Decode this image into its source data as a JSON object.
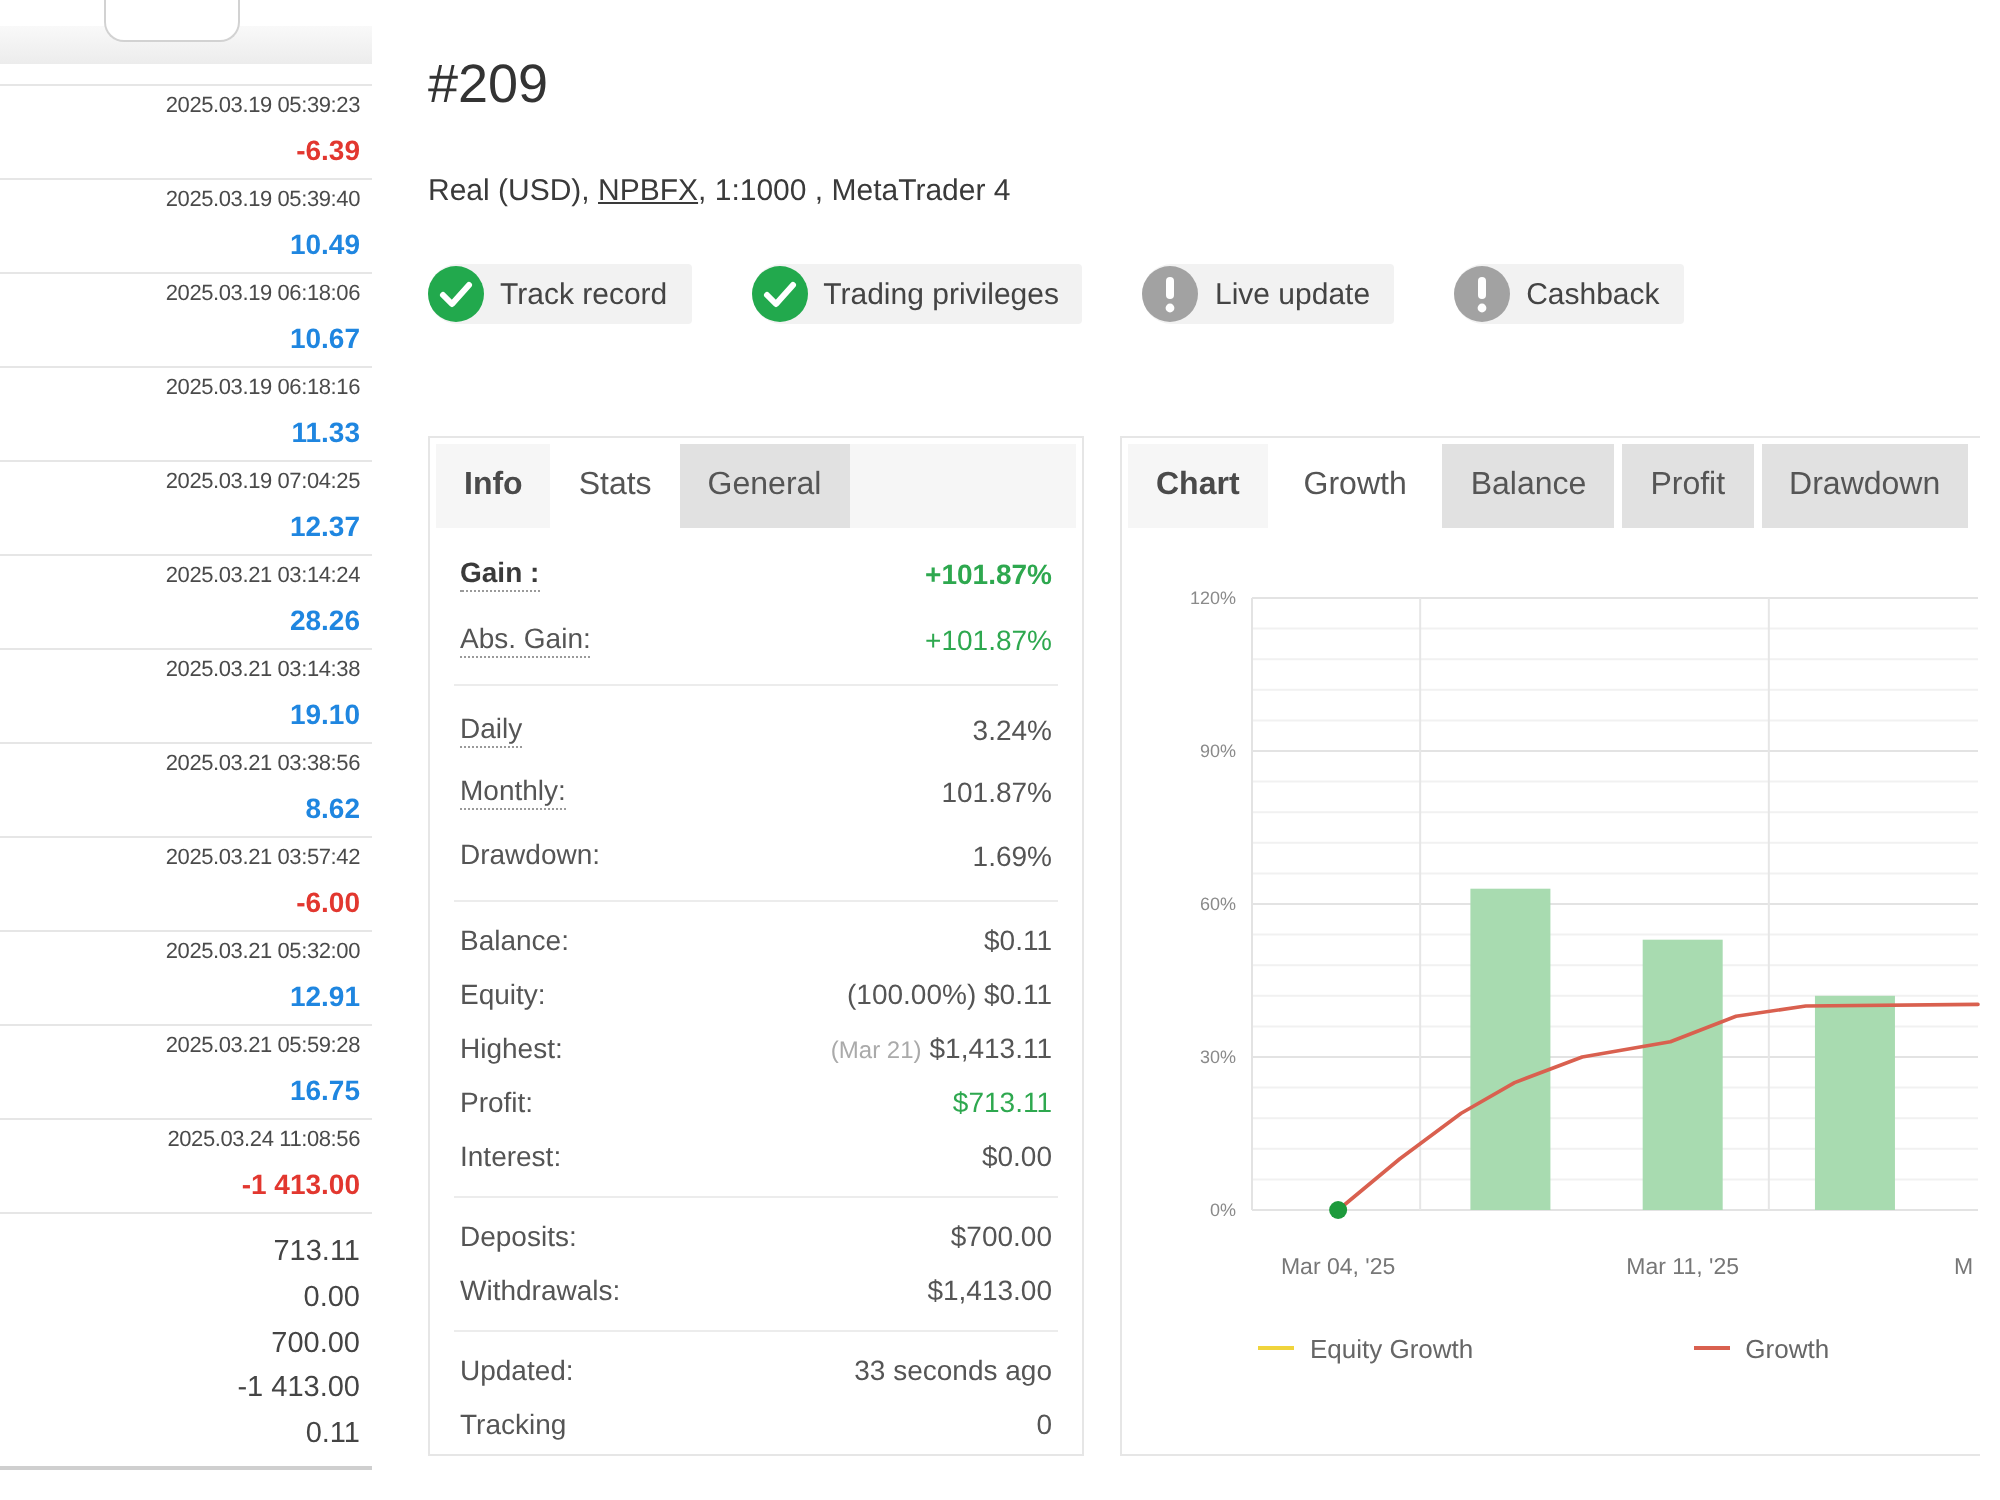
{
  "trade_list": {
    "trades": [
      {
        "time": "2025.03.19 05:39:23",
        "amount": "-6.39",
        "negative": true
      },
      {
        "time": "2025.03.19 05:39:40",
        "amount": "10.49",
        "negative": false
      },
      {
        "time": "2025.03.19 06:18:06",
        "amount": "10.67",
        "negative": false
      },
      {
        "time": "2025.03.19 06:18:16",
        "amount": "11.33",
        "negative": false
      },
      {
        "time": "2025.03.19 07:04:25",
        "amount": "12.37",
        "negative": false
      },
      {
        "time": "2025.03.21 03:14:24",
        "amount": "28.26",
        "negative": false
      },
      {
        "time": "2025.03.21 03:14:38",
        "amount": "19.10",
        "negative": false
      },
      {
        "time": "2025.03.21 03:38:56",
        "amount": "8.62",
        "negative": false
      },
      {
        "time": "2025.03.21 03:57:42",
        "amount": "-6.00",
        "negative": true
      },
      {
        "time": "2025.03.21 05:32:00",
        "amount": "12.91",
        "negative": false
      },
      {
        "time": "2025.03.21 05:59:28",
        "amount": "16.75",
        "negative": false
      },
      {
        "time": "2025.03.24 11:08:56",
        "amount": "-1 413.00",
        "negative": true
      }
    ],
    "totals": [
      "713.11",
      "0.00",
      "700.00",
      "-1 413.00",
      "0.11"
    ]
  },
  "account": {
    "title": "#209",
    "summary": {
      "before": "Real (USD), ",
      "link": "NPBFX",
      "after": ", 1:1000 , MetaTrader 4"
    }
  },
  "badges": [
    {
      "label": "Track record",
      "verified": true
    },
    {
      "label": "Trading privileges",
      "verified": true
    },
    {
      "label": "Live update",
      "verified": false
    },
    {
      "label": "Cashback",
      "verified": false
    }
  ],
  "stats_panel": {
    "heading": "Info",
    "tabs": [
      {
        "label": "Stats",
        "selected": true
      },
      {
        "label": "General",
        "selected": false
      }
    ],
    "groups": [
      [
        {
          "label": "Gain :",
          "value": "+101.87%",
          "positive": true,
          "bold": true,
          "underlined": true
        },
        {
          "label": "Abs. Gain:",
          "value": "+101.87%",
          "positive": true,
          "bold": false,
          "underlined": true
        }
      ],
      [
        {
          "label": "Daily",
          "value": "3.24%",
          "positive": false,
          "bold": false,
          "underlined": true
        },
        {
          "label": "Monthly:",
          "value": "101.87%",
          "positive": false,
          "bold": false,
          "underlined": true
        },
        {
          "label": "Drawdown:",
          "value": "1.69%",
          "positive": false,
          "bold": false,
          "underlined": false
        }
      ],
      [
        {
          "label": "Balance:",
          "value": "$0.11",
          "positive": false,
          "bold": false,
          "underlined": false
        },
        {
          "label": "Equity:",
          "value": "(100.00%) $0.11",
          "positive": false,
          "bold": false,
          "underlined": false
        },
        {
          "label": "Highest:",
          "note": "(Mar 21)",
          "value": "$1,413.11",
          "positive": false,
          "bold": false,
          "underlined": false
        },
        {
          "label": "Profit:",
          "value": "$713.11",
          "positive": true,
          "bold": false,
          "underlined": false
        },
        {
          "label": "Interest:",
          "value": "$0.00",
          "positive": false,
          "bold": false,
          "underlined": false
        }
      ],
      [
        {
          "label": "Deposits:",
          "value": "$700.00",
          "positive": false,
          "bold": false,
          "underlined": false
        },
        {
          "label": "Withdrawals:",
          "value": "$1,413.00",
          "positive": false,
          "bold": false,
          "underlined": false
        }
      ],
      [
        {
          "label": "Updated:",
          "value": "33 seconds ago",
          "positive": false,
          "bold": false,
          "underlined": false
        },
        {
          "label": "Tracking",
          "value": "0",
          "positive": false,
          "bold": false,
          "underlined": false
        }
      ]
    ]
  },
  "chart_panel": {
    "heading": "Chart",
    "tabs": [
      {
        "label": "Growth",
        "selected": true
      },
      {
        "label": "Balance",
        "selected": false
      },
      {
        "label": "Profit",
        "selected": false
      },
      {
        "label": "Drawdown",
        "selected": false
      }
    ],
    "chart_data": [
      {
        "type": "bar",
        "grid": true,
        "legend": "bottom",
        "xlim": [
          "2025-03-02T06:00",
          "2025-03-17"
        ],
        "ylim": [
          0,
          120
        ],
        "yticks": [
          {
            "value": 0,
            "label": "0%"
          },
          {
            "value": 30,
            "label": "30%"
          },
          {
            "value": 60,
            "label": "60%"
          },
          {
            "value": 90,
            "label": "90%"
          },
          {
            "value": 120,
            "label": "120%"
          }
        ],
        "xticks": [
          {
            "value": "2025-03-04",
            "label": "Mar 04, '25"
          },
          {
            "value": "2025-03-11",
            "label": "Mar 11, '25"
          },
          {
            "value": "2025-03-16T17:00",
            "label": "M"
          }
        ],
        "ref_lines": [
          {
            "axis": "x",
            "value": "2025-03-05T16:00",
            "color": "#e6e6e6",
            "line_style": "solid"
          },
          {
            "axis": "x",
            "value": "2025-03-12T18:00",
            "color": "#e6e6e6",
            "line_style": "solid"
          }
        ],
        "series": [
          {
            "color": "#a8dbb0",
            "x": [
              "2025-03-07T12:00",
              "2025-03-11",
              "2025-03-14T12:00"
            ],
            "values": [
              63,
              53,
              42
            ]
          },
          {
            "name": "Equity Growth",
            "type": "line",
            "color": "#f0d43c"
          },
          {
            "name": "Growth",
            "type": "line",
            "color": "#d9604f",
            "x": [
              "2025-03-04",
              "2025-03-05T06:00",
              "2025-03-06T12:00",
              "2025-03-07T14:00",
              "2025-03-08T23:00",
              "2025-03-10T18:00",
              "2025-03-12T02:00",
              "2025-03-13T12:00",
              "2025-03-17"
            ],
            "values": [
              0,
              10,
              19,
              25,
              30,
              33,
              38,
              40,
              40.3
            ]
          }
        ]
      }
    ]
  }
}
